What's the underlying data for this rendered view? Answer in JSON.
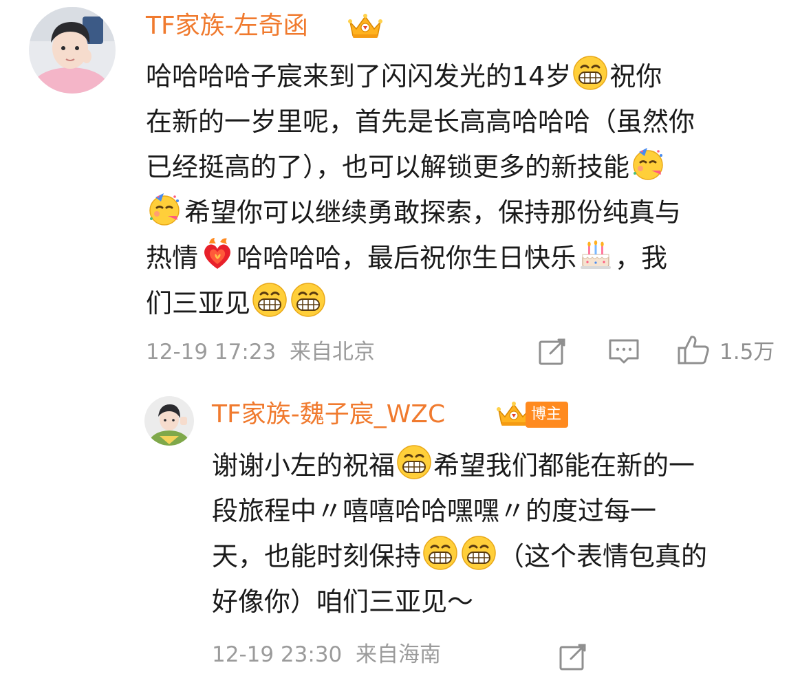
{
  "comment": {
    "username": "TF家族-左奇函",
    "lines": [
      "哈哈哈哈子宸来到了闪闪发光的14岁",
      "祝你",
      "在新的一岁里呢，首先是长高高哈哈哈（虽然你",
      "已经挺高的了），也可以解锁更多的新技能",
      "希望你可以继续勇敢探索，保持那份纯真与",
      "热情",
      "哈哈哈哈，最后祝你生日快乐",
      "，我",
      "们三亚见"
    ],
    "time": "12-19 17:23",
    "location": "来自北京",
    "like_count": "1.5万"
  },
  "reply": {
    "username": "TF家族-魏子宸_WZC",
    "host_label": "博主",
    "lines": [
      "谢谢小左的祝福",
      "希望我们都能在新的一",
      "段旅程中〃嘻嘻哈哈嘿嘿〃的度过每一",
      "天，也能时刻保持",
      "（这个表情包真的",
      "好像你）咱们三亚见～"
    ],
    "time": "12-19 23:30",
    "location": "来自海南"
  },
  "icons": {
    "grin": "grinning-face-emoji",
    "party": "partying-face-emoji",
    "heart": "heart-on-fire-emoji",
    "cake": "birthday-cake-emoji",
    "repost": "edit-repost-icon",
    "comment": "comment-icon",
    "like": "thumbs-up-icon",
    "crown": "crown-badge-icon"
  },
  "colors": {
    "username": "#f07a2e",
    "meta": "#9b9b9b",
    "host_tag": "#ff8a1f"
  }
}
